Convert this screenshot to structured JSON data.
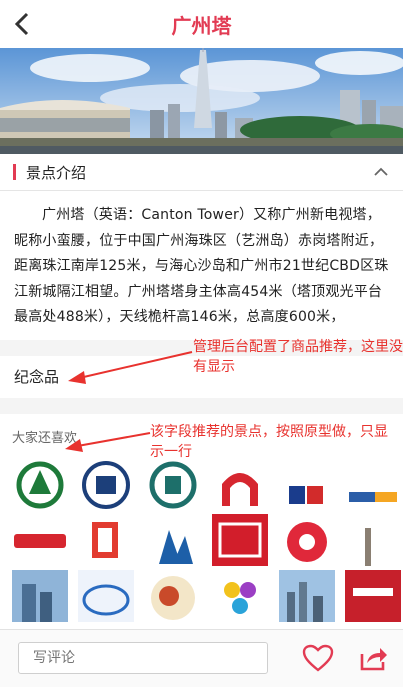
{
  "header": {
    "title": "广州塔",
    "back_icon": "back-chevron-icon"
  },
  "hero": {
    "alt": "广州塔"
  },
  "attraction_intro": {
    "heading": "景点介绍",
    "collapse_icon": "chevron-up-icon",
    "text": "广州塔（英语：Canton Tower）又称广州新电视塔，昵称小蛮腰，位于中国广州海珠区（艺洲岛）赤岗塔附近，距离珠江南岸125米，与海心沙岛和广州市21世纪CBD区珠江新城隔江相望。广州塔塔身主体高454米（塔顶观光平台最高处488米），天线桅杆高146米，总高度600米，"
  },
  "souvenir": {
    "heading": "纪念品"
  },
  "recommend": {
    "heading": "大家还喜欢"
  },
  "annotations": {
    "note1": "管理后台配置了商品推荐，这里没有显示",
    "note2": "该字段推荐的景点，按照原型做，只显示一行"
  },
  "footer": {
    "comment_placeholder": "写评论",
    "favorite_icon": "heart-icon",
    "share_icon": "share-icon"
  },
  "colors": {
    "accent": "#e23b53",
    "annotation": "#e8322e"
  }
}
